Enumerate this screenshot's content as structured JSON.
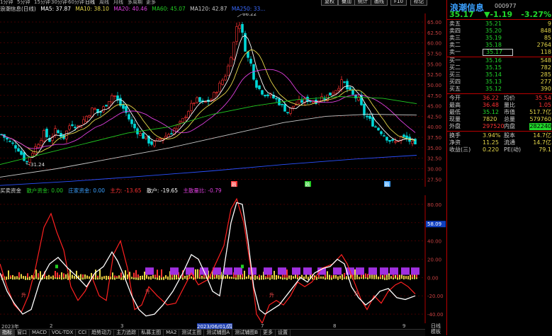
{
  "top_tabs": [
    "1分钟",
    "5分钟",
    "15分钟",
    "30分钟",
    "60分钟",
    "日线",
    "周线",
    "月线",
    "多周期",
    "更多"
  ],
  "top_buttons": [
    "复权",
    "叠加",
    "统计",
    "画线",
    "F10",
    "标记"
  ],
  "header": {
    "stock": "浪潮信息(日线)",
    "ma5": "MA5: 37.87",
    "ma10": "MA10: 38.10",
    "ma20": "MA20: 40.46",
    "ma60": "MA60: 45.07",
    "ma120": "MA120: 42.87",
    "ma250": "MA250: 33..."
  },
  "colors": {
    "up": "#ff3232",
    "down": "#00d8d8",
    "ma5": "#ffffff",
    "ma10": "#e6d84a",
    "ma20": "#e040e0",
    "ma60": "#22cc22",
    "ma120": "#c8c8c8",
    "ma250": "#2a50ff",
    "grid": "#6a0000",
    "panel_border": "#b00000"
  },
  "main_chart": {
    "y_ticks": [
      "65.00",
      "62.50",
      "60.00",
      "57.50",
      "55.00",
      "52.50",
      "50.00",
      "47.50",
      "45.00",
      "42.50",
      "40.00",
      "37.50",
      "35.00",
      "32.50",
      "30.00",
      "27.50"
    ],
    "high_label": "66.22",
    "low_label": "31.24",
    "markers": [
      "融",
      "融",
      "融"
    ]
  },
  "indicator": {
    "name": "买卖资金",
    "a": "散户资金: 0.00",
    "b": "庄家资金: 0.00",
    "c": "主力: -13.65",
    "d": "散户: -19.65",
    "e": "主散量比: -0.79",
    "y_ticks": [
      "80.00",
      "60.00",
      "40.00",
      "20.00",
      "0.00",
      "-20.00",
      "-40.00"
    ],
    "current_tag": "58.09",
    "marks": [
      "升",
      "升",
      "升",
      "升"
    ]
  },
  "x_axis": [
    "2023年",
    "2",
    "3",
    "2023/06/01/四",
    "7",
    "8",
    "9"
  ],
  "bottom_tabs": [
    "指标",
    "窗口",
    "MACD",
    "VOL-TDX",
    "CCI",
    "趋势动力",
    "主力追踪",
    "私募主图",
    "MA2",
    "测试主图",
    "测试辅图A",
    "测试辅图B",
    "更多",
    "设置"
  ],
  "bottom_right": [
    "日线",
    "模板"
  ],
  "side": {
    "name": "浪潮信息",
    "code": "000977",
    "price": "35.17",
    "change": "▼-1.19",
    "pct": "-3.27%",
    "asks": [
      {
        "label": "卖五",
        "price": "35.21",
        "vol": "9"
      },
      {
        "label": "卖四",
        "price": "35.20",
        "vol": "848"
      },
      {
        "label": "卖三",
        "price": "35.19",
        "vol": "85"
      },
      {
        "label": "卖二",
        "price": "35.18",
        "vol": "2764"
      },
      {
        "label": "卖一",
        "price": "35.17",
        "vol": "118"
      }
    ],
    "bids": [
      {
        "label": "买一",
        "price": "35.16",
        "vol": "548"
      },
      {
        "label": "买二",
        "price": "35.15",
        "vol": "782"
      },
      {
        "label": "买三",
        "price": "35.14",
        "vol": "285"
      },
      {
        "label": "买四",
        "price": "35.13",
        "vol": "277"
      },
      {
        "label": "买五",
        "price": "35.12",
        "vol": "390"
      }
    ],
    "stats": [
      {
        "k1": "今开",
        "v1": "36.22",
        "k2": "均价",
        "v2": "35.54"
      },
      {
        "k1": "最高",
        "v1": "36.48",
        "k2": "量比",
        "v2": "1.05"
      },
      {
        "k1": "最低",
        "v1": "35.12",
        "k2": "市值",
        "v2": "517.7亿"
      },
      {
        "k1": "现量",
        "v1": "7820",
        "k2": "总量",
        "v2": "579760"
      },
      {
        "k1": "外盘",
        "v1": "297520",
        "k2": "内盘",
        "v2": "282240"
      }
    ],
    "stats2": [
      {
        "k1": "换手",
        "v1": "3.94%",
        "k2": "股本",
        "v2": "14.7亿"
      },
      {
        "k1": "净资",
        "v1": "11.25",
        "k2": "流通",
        "v2": "14.7亿"
      },
      {
        "k1": "收益(三)",
        "v1": "0.220",
        "k2": "PE(动)",
        "v2": "79.1"
      }
    ]
  }
}
